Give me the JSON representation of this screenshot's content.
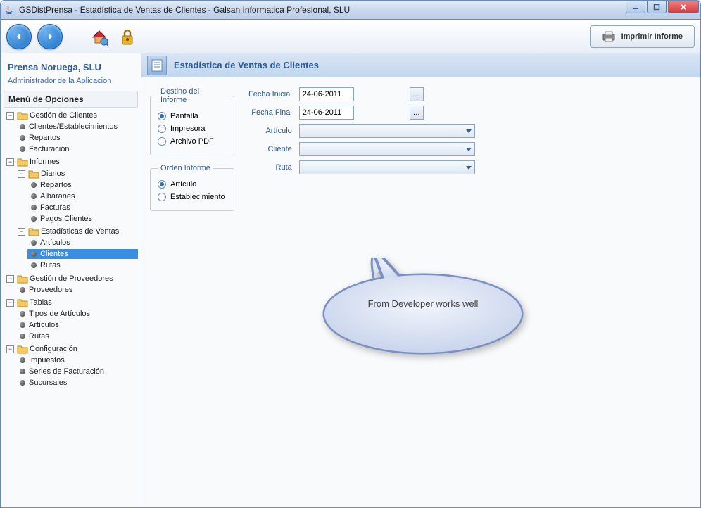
{
  "window": {
    "title": "GSDistPrensa - Estadística de Ventas de Clientes - Galsan Informatica Profesional, SLU"
  },
  "toolbar": {
    "print_label": "Imprimir Informe"
  },
  "sidebar": {
    "company": "Prensa Noruega, SLU",
    "role": "Administrador de la Aplicacion",
    "menu_header": "Menú de Opciones",
    "tree": {
      "gestion_clientes": "Gestión de Clientes",
      "clientes_estab": "Clientes/Establecimientos",
      "repartos": "Repartos",
      "facturacion": "Facturación",
      "informes": "Informes",
      "diarios": "Diarios",
      "d_repartos": "Repartos",
      "d_albaranes": "Albaranes",
      "d_facturas": "Facturas",
      "d_pagos": "Pagos Clientes",
      "est_ventas": "Estadísticas de Ventas",
      "ev_articulos": "Artículos",
      "ev_clientes": "Clientes",
      "ev_rutas": "Rutas",
      "gestion_prov": "Gestión de Proveedores",
      "proveedores": "Proveedores",
      "tablas": "Tablas",
      "tipos_art": "Tipos de Artículos",
      "t_articulos": "Artículos",
      "t_rutas": "Rutas",
      "config": "Configuración",
      "impuestos": "Impuestos",
      "series_fact": "Series de Facturación",
      "sucursales": "Sucursales"
    }
  },
  "content": {
    "title": "Estadística de Ventas de Clientes",
    "destino": {
      "legend": "Destino del Informe",
      "pantalla": "Pantalla",
      "impresora": "Impresora",
      "pdf": "Archivo PDF",
      "selected": "pantalla"
    },
    "orden": {
      "legend": "Orden Informe",
      "articulo": "Artículo",
      "establecimiento": "Establecimiento",
      "selected": "articulo"
    },
    "filters": {
      "fecha_inicial_label": "Fecha Inicial",
      "fecha_inicial_value": "24-06-2011",
      "fecha_final_label": "Fecha Final",
      "fecha_final_value": "24-06-2011",
      "articulo_label": "Artículo",
      "cliente_label": "Cliente",
      "ruta_label": "Ruta"
    }
  },
  "callout": {
    "text": "From Developer works well"
  }
}
